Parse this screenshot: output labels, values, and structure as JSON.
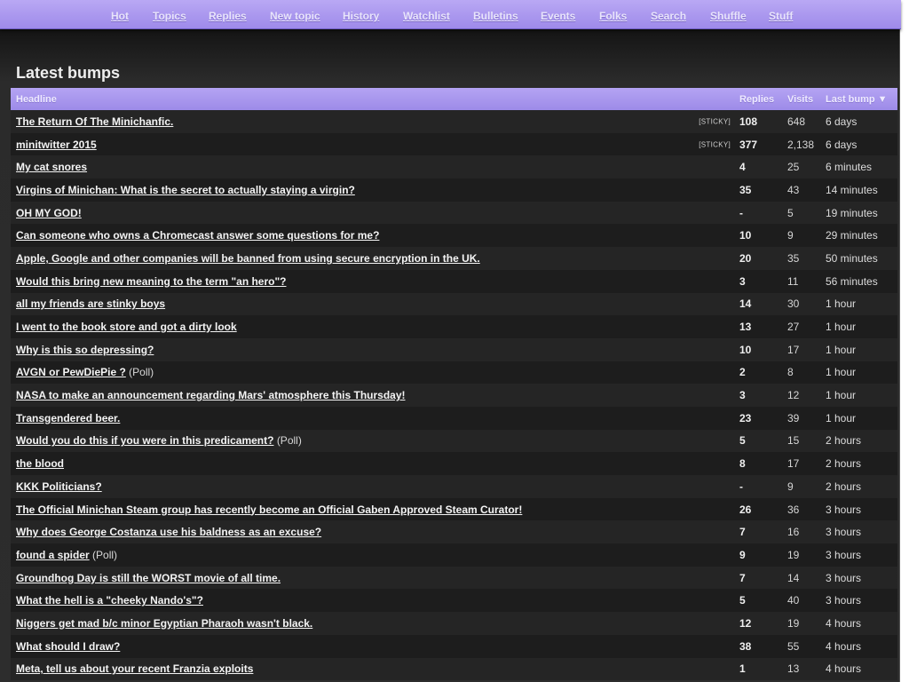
{
  "nav": [
    {
      "label": "Hot"
    },
    {
      "label": "Topics"
    },
    {
      "label": "Replies"
    },
    {
      "label": "New topic"
    },
    {
      "label": "History"
    },
    {
      "label": "Watchlist"
    },
    {
      "label": "Bulletins"
    },
    {
      "label": "Events"
    },
    {
      "label": "Folks"
    },
    {
      "label": "Search"
    },
    {
      "label": "Shuffle"
    },
    {
      "label": "Stuff"
    }
  ],
  "page_title": "Latest bumps",
  "table": {
    "headers": {
      "headline": "Headline",
      "replies": "Replies",
      "visits": "Visits",
      "last_bump": "Last bump ▼"
    },
    "rows": [
      {
        "headline": "The Return Of The Minichanfic.",
        "sticky": "[STICKY]",
        "replies": "108",
        "visits": "648",
        "last_bump": "6 days"
      },
      {
        "headline": "minitwitter 2015",
        "sticky": "[STICKY]",
        "replies": "377",
        "visits": "2,138",
        "last_bump": "6 days"
      },
      {
        "headline": "My cat snores",
        "replies": "4",
        "visits": "25",
        "last_bump": "6 minutes"
      },
      {
        "headline": "Virgins of Minichan: What is the secret to actually staying a virgin?",
        "replies": "35",
        "visits": "43",
        "last_bump": "14 minutes"
      },
      {
        "headline": "OH MY GOD!",
        "replies": "-",
        "visits": "5",
        "last_bump": "19 minutes"
      },
      {
        "headline": "Can someone who owns a Chromecast answer some questions for me?",
        "replies": "10",
        "visits": "9",
        "last_bump": "29 minutes"
      },
      {
        "headline": "Apple, Google and other companies will be banned from using secure encryption in the UK.",
        "replies": "20",
        "visits": "35",
        "last_bump": "50 minutes"
      },
      {
        "headline": "Would this bring new meaning to the term \"an hero\"?",
        "replies": "3",
        "visits": "11",
        "last_bump": "56 minutes"
      },
      {
        "headline": "all my friends are stinky boys",
        "replies": "14",
        "visits": "30",
        "last_bump": "1 hour"
      },
      {
        "headline": "I went to the book store and got a dirty look",
        "replies": "13",
        "visits": "27",
        "last_bump": "1 hour"
      },
      {
        "headline": "Why is this so depressing?",
        "replies": "10",
        "visits": "17",
        "last_bump": "1 hour"
      },
      {
        "headline": "AVGN or PewDiePie ?",
        "poll": "(Poll)",
        "replies": "2",
        "visits": "8",
        "last_bump": "1 hour"
      },
      {
        "headline": "NASA to make an announcement regarding Mars' atmosphere this Thursday!",
        "replies": "3",
        "visits": "12",
        "last_bump": "1 hour"
      },
      {
        "headline": "Transgendered beer.",
        "replies": "23",
        "visits": "39",
        "last_bump": "1 hour"
      },
      {
        "headline": "Would you do this if you were in this predicament?",
        "poll": "(Poll)",
        "replies": "5",
        "visits": "15",
        "last_bump": "2 hours"
      },
      {
        "headline": "the blood",
        "replies": "8",
        "visits": "17",
        "last_bump": "2 hours"
      },
      {
        "headline": "KKK Politicians?",
        "replies": "-",
        "visits": "9",
        "last_bump": "2 hours"
      },
      {
        "headline": "The Official Minichan Steam group has recently become an Official Gaben Approved Steam Curator!",
        "replies": "26",
        "visits": "36",
        "last_bump": "3 hours"
      },
      {
        "headline": "Why does George Costanza use his baldness as an excuse?",
        "replies": "7",
        "visits": "16",
        "last_bump": "3 hours"
      },
      {
        "headline": "found a spider",
        "poll": "(Poll)",
        "replies": "9",
        "visits": "19",
        "last_bump": "3 hours"
      },
      {
        "headline": "Groundhog Day is still the WORST movie of all time.",
        "replies": "7",
        "visits": "14",
        "last_bump": "3 hours"
      },
      {
        "headline": "What the hell is a \"cheeky Nando's\"?",
        "replies": "5",
        "visits": "40",
        "last_bump": "3 hours"
      },
      {
        "headline": "Niggers get mad b/c minor Egyptian Pharaoh wasn't black.",
        "replies": "12",
        "visits": "19",
        "last_bump": "4 hours"
      },
      {
        "headline": "What should I draw?",
        "replies": "38",
        "visits": "55",
        "last_bump": "4 hours"
      },
      {
        "headline": "Meta, tell us about your recent Franzia exploits",
        "replies": "1",
        "visits": "13",
        "last_bump": "4 hours"
      }
    ]
  }
}
